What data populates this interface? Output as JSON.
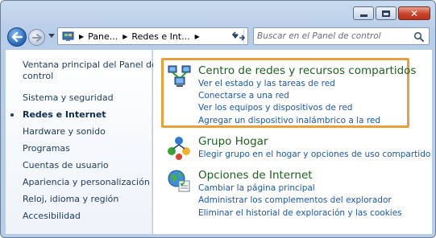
{
  "window": {
    "caption_buttons": [
      "minimize",
      "maximize",
      "close"
    ]
  },
  "navigation": {
    "breadcrumbs": [
      "Pane...",
      "Redes e Int...",
      ""
    ],
    "search": {
      "placeholder": "Buscar en el Panel de control"
    }
  },
  "sidebar": {
    "items": [
      {
        "label": "Ventana principal del Panel de"
      },
      {
        "label": "control"
      },
      {
        "label": "Sistema y seguridad"
      },
      {
        "label": "Redes e Internet",
        "active": true
      },
      {
        "label": "Hardware y sonido"
      },
      {
        "label": "Programas"
      },
      {
        "label": "Cuentas de usuario"
      },
      {
        "label": "Apariencia y personalización"
      },
      {
        "label": "Reloj, idioma y región"
      },
      {
        "label": "Accesibilidad"
      }
    ]
  },
  "categories": [
    {
      "title": "Centro de redes y recursos compartidos",
      "icon": "network-center-icon",
      "highlighted": true,
      "links": [
        "Ver el estado y las tareas de red",
        "Conectarse a una red",
        "Ver los equipos y dispositivos de red",
        "Agregar un dispositivo inalámbrico a la red"
      ]
    },
    {
      "title": "Grupo Hogar",
      "icon": "homegroup-icon",
      "links": [
        "Elegir grupo en el hogar y opciones de uso compartido"
      ]
    },
    {
      "title": "Opciones de Internet",
      "icon": "internet-options-icon",
      "links": [
        "Cambiar la página principal",
        "Administrar los complementos del explorador",
        "Eliminar el historial de exploración y las cookies"
      ]
    }
  ],
  "colors": {
    "highlight_border": "#e8a13a",
    "category_title": "#1e5f1e",
    "link": "#1a57a8",
    "sidebar_text": "#1e395b"
  }
}
